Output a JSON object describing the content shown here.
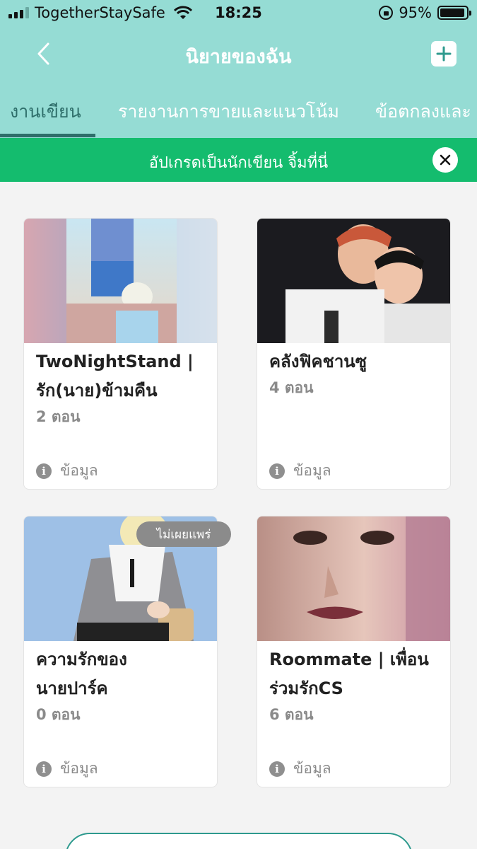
{
  "status_bar": {
    "carrier": "TogetherStaySafe",
    "time": "18:25",
    "battery": "95%",
    "battery_level": 0.95
  },
  "header": {
    "title": "นิยายของฉัน",
    "back_icon": "chevron-left-icon",
    "add_icon": "plus-icon"
  },
  "tabs": [
    {
      "label": "งานเขียน",
      "active": true
    },
    {
      "label": "รายงานการขายและแนวโน้ม",
      "active": false
    },
    {
      "label": "ข้อตกลงและ",
      "active": false
    }
  ],
  "banner": {
    "text": "อัปเกรดเป็นนักเขียน จิ้มที่นี่",
    "close_icon": "close-icon"
  },
  "novels": [
    {
      "title_line1": "TwoNightStand |",
      "title_line2": "รัก(นาย)ข้ามคืน",
      "episodes": "2 ตอน",
      "info": "ข้อมูล"
    },
    {
      "title_line1": "คลังฟิคชานซู",
      "title_line2": "",
      "episodes": "4 ตอน",
      "info": "ข้อมูล"
    },
    {
      "title_line1": "ความรักของ",
      "title_line2": "นายปาร์ค",
      "episodes": "0 ตอน",
      "info": "ข้อมูล",
      "badge": "ไม่เผยแพร่"
    },
    {
      "title_line1": "Roommate | เพื่อน",
      "title_line2": "ร่วมรักCS",
      "episodes": "6 ตอน",
      "info": "ข้อมูล"
    }
  ],
  "colors": {
    "header_bg": "#95dcd4",
    "banner_bg": "#14bc6e",
    "active_tab": "#2e6e6a"
  }
}
